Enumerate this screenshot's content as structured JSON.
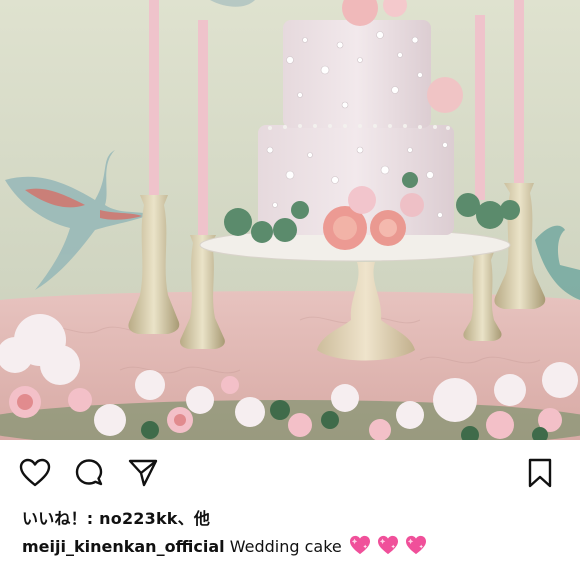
{
  "post": {
    "image_description_alt": "",
    "likes": {
      "prefix": "いいね！: ",
      "user": "no223kk",
      "suffix": "、他"
    },
    "caption": {
      "username": "meiji_kinenkan_official",
      "text": " Wedding cake",
      "emoji": [
        "sparkling-heart-icon",
        "sparkling-heart-icon",
        "sparkling-heart-icon"
      ]
    }
  },
  "actions": {
    "like": "heart-icon",
    "comment": "comment-bubble-icon",
    "share": "paper-plane-icon",
    "save": "bookmark-icon"
  },
  "colors": {
    "emoji_pink": "#f0509a",
    "icon": "#111111"
  }
}
